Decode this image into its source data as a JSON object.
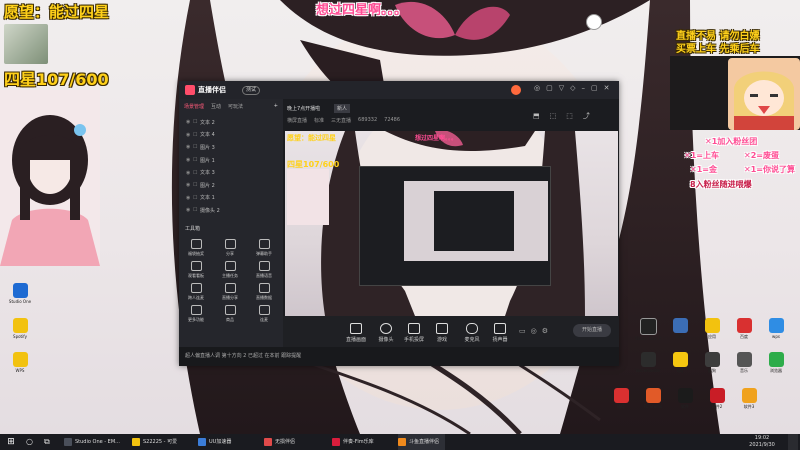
{
  "overlay": {
    "wish_text": "愿望：能过四星",
    "star_count": "四星107/600",
    "center_banner": "想过四星啊。。。",
    "top_right_line1": "直播不易 请勿白嫖",
    "top_right_line2": "买票上车 先乘后车",
    "gift_lines": [
      "✕1加入粉丝团",
      "✕1=上车",
      "✕2=废蛋",
      "✕1=金",
      "✕1=你说了算",
      "8入粉丝随进喂爆"
    ],
    "colors": {
      "yellow": "#ffd11a",
      "pink": "#ff4d94"
    }
  },
  "desktop_icons": [
    "Studio One",
    "Spotify",
    "WPS",
    "Studio One 2",
    "OBS",
    "应用",
    "百度",
    "wps",
    "Voicemeeter",
    "QQ",
    "酷狗",
    "音乐",
    "浏览器",
    "通用",
    "FL Studio",
    "软件",
    "软件2",
    "软件3"
  ],
  "app": {
    "title": "直播伴侣",
    "title_badge": "测试",
    "sidebar_tabs": [
      "场景管理",
      "互动",
      "可玩法"
    ],
    "scenes": [
      "文本 2",
      "文本 4",
      "图片 3",
      "图片 1",
      "文本 3",
      "图片 2",
      "文本 1",
      "摄像头 2"
    ],
    "tools_title": "工具箱",
    "tools": [
      [
        "福袋抽奖",
        "分享",
        "弹幕助手"
      ],
      [
        "观看看板",
        "主播任务",
        "直播语音"
      ],
      [
        "跨人连麦",
        "直播分享",
        "直播数据"
      ],
      [
        "更多功能",
        "商品",
        "连麦"
      ]
    ],
    "main_tabs": [
      "直播间设置",
      "推荐"
    ],
    "main_tab_badge": "新人",
    "main_title": "晚上7点开播啦",
    "main_subtitle_items": [
      "横屏直播",
      "标准",
      "三无直播",
      "689332"
    ],
    "main_like_count": "72486",
    "bottom_buttons": [
      "直播画面",
      "摄像头",
      "手机投屏",
      "游戏",
      "麦克风",
      "扬声器"
    ],
    "start_button": "开始直播",
    "status_text": "超人偏直播人调 第十方向 2 已超过 在本前 跟踪提醒"
  },
  "taskbar": {
    "items": [
      "Studio One - EM...",
      "S22225 - 可爱",
      "UU加速器",
      "无损伴侣",
      "伴奏-Fim乐库",
      "斗鱼直播伴侣"
    ],
    "time": "19:02",
    "date": "2021/9/30"
  }
}
